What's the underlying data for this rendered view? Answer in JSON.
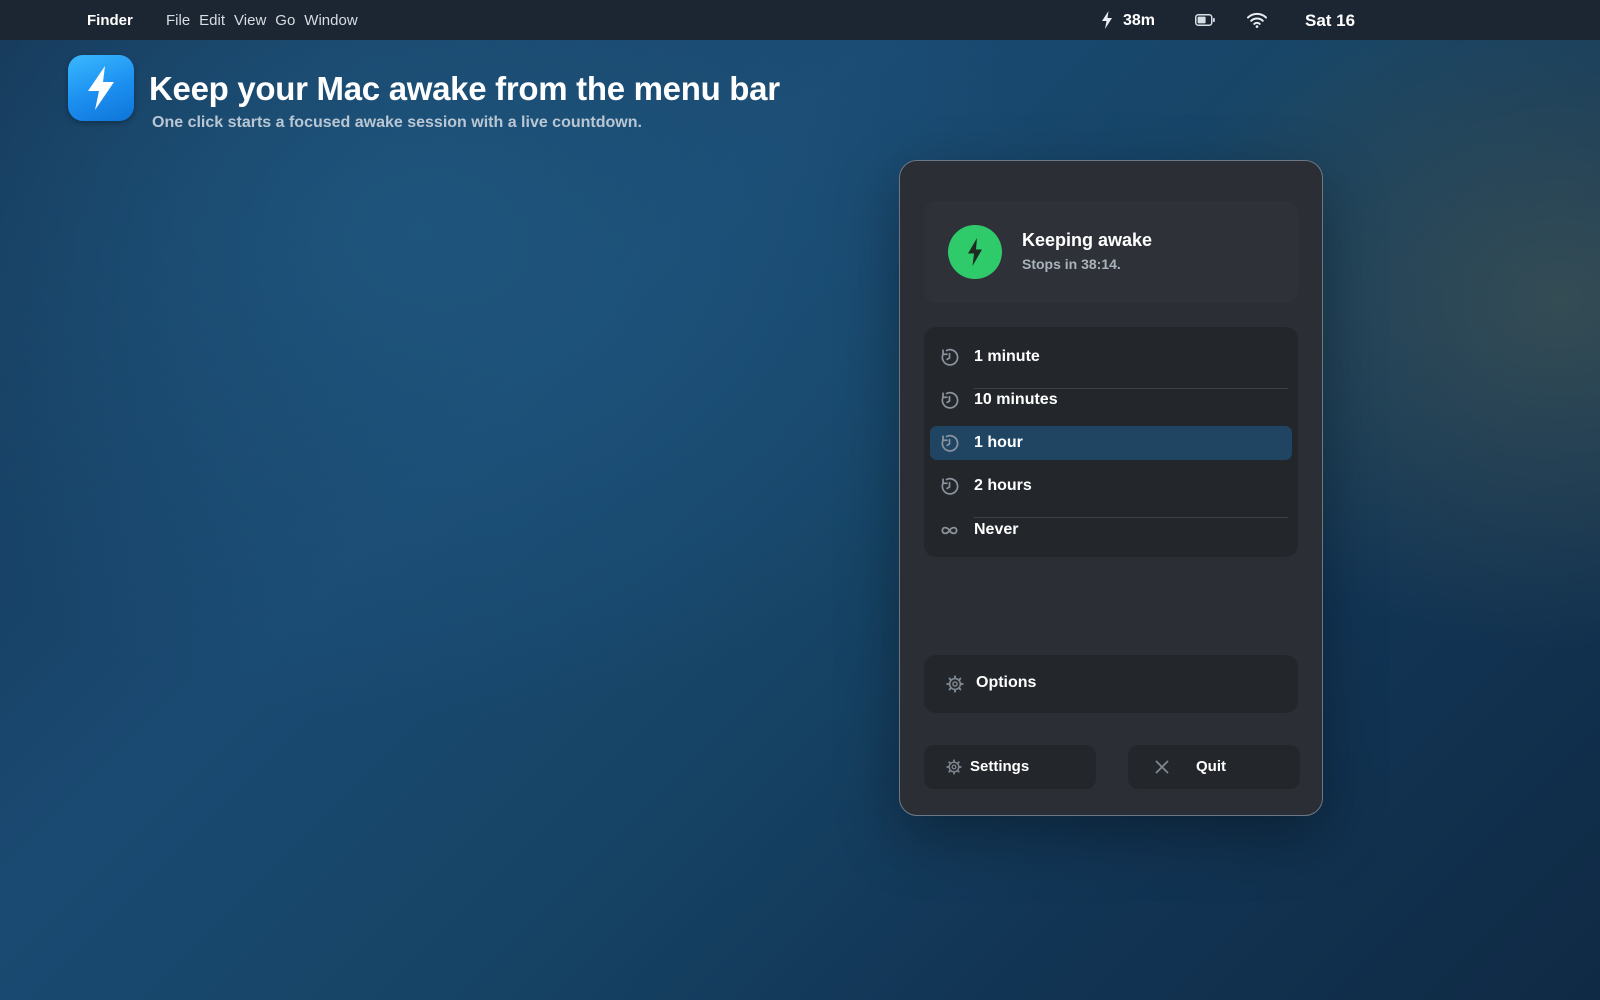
{
  "menubar": {
    "app_name": "Finder",
    "menus": [
      "File",
      "Edit",
      "View",
      "Go",
      "Window"
    ],
    "status": {
      "bolt_icon": "bolt-icon",
      "timer": "38m",
      "battery_icon": "battery-icon",
      "wifi_icon": "wifi-icon",
      "date": "Sat 16"
    }
  },
  "hero": {
    "icon": "bolt-app-icon",
    "title": "Keep your Mac awake from the menu bar",
    "subtitle": "One click starts a focused awake session with a live countdown."
  },
  "panel": {
    "status": {
      "icon": "bolt-icon",
      "title": "Keeping awake",
      "subtitle": "Stops in 38:14."
    },
    "durations": [
      {
        "label": "1 minute",
        "icon": "timer-icon",
        "selected": false
      },
      {
        "label": "10 minutes",
        "icon": "timer-icon",
        "selected": false
      },
      {
        "label": "1 hour",
        "icon": "timer-icon",
        "selected": true
      },
      {
        "label": "2 hours",
        "icon": "timer-icon",
        "selected": false
      },
      {
        "label": "Never",
        "icon": "infinity-icon",
        "selected": false
      }
    ],
    "options": {
      "label": "Options",
      "icon": "gear-icon"
    },
    "settings_button": {
      "label": "Settings",
      "icon": "gear-icon"
    },
    "quit_button": {
      "label": "Quit",
      "icon": "close-icon"
    }
  },
  "colors": {
    "accent_green": "#2fcb6a",
    "selected_row": "#1f4563",
    "app_icon_blue": "#1b8ff0"
  }
}
